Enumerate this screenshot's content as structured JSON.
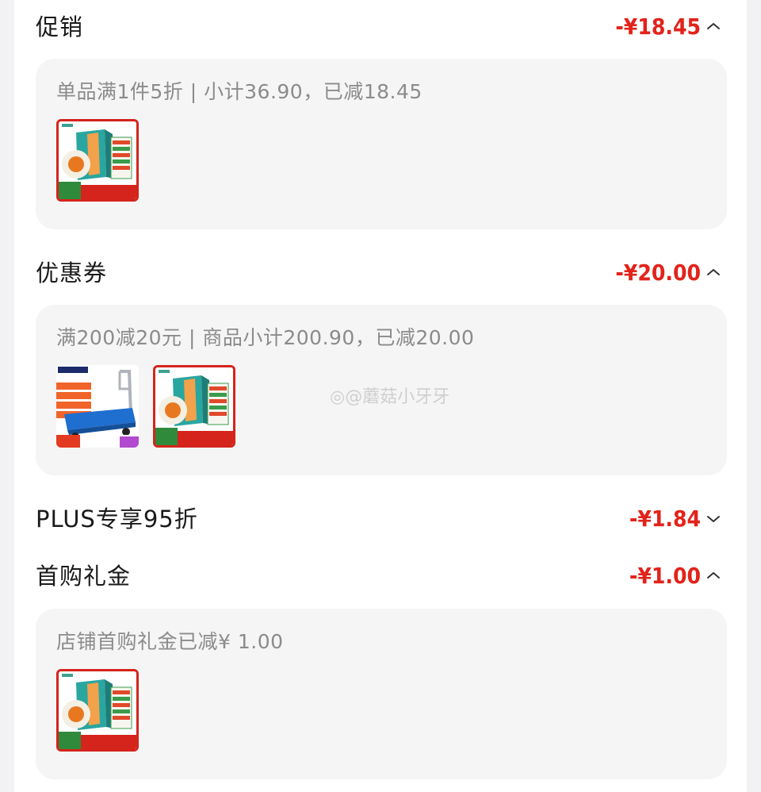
{
  "sections": [
    {
      "title": "促销",
      "amount": "-¥18.45",
      "expanded": true,
      "description": "单品满1件5折 | 小计36.90，已减18.45",
      "products": [
        "salted-egg-box"
      ]
    },
    {
      "title": "优惠券",
      "amount": "-¥20.00",
      "expanded": true,
      "description": "满200减20元 | 商品小计200.90，已减20.00",
      "products": [
        "platform-trolley",
        "salted-egg-box"
      ]
    },
    {
      "title": "PLUS专享95折",
      "amount": "-¥1.84",
      "expanded": false
    },
    {
      "title": "首购礼金",
      "amount": "-¥1.00",
      "expanded": true,
      "description": "店铺首购礼金已减¥ 1.00",
      "products": [
        "salted-egg-box"
      ]
    }
  ],
  "watermark": "@蘑菇小牙牙",
  "colors": {
    "amount_red": "#e2231a",
    "card_bg": "#f5f5f6",
    "page_bg": "#f2f2f4"
  }
}
